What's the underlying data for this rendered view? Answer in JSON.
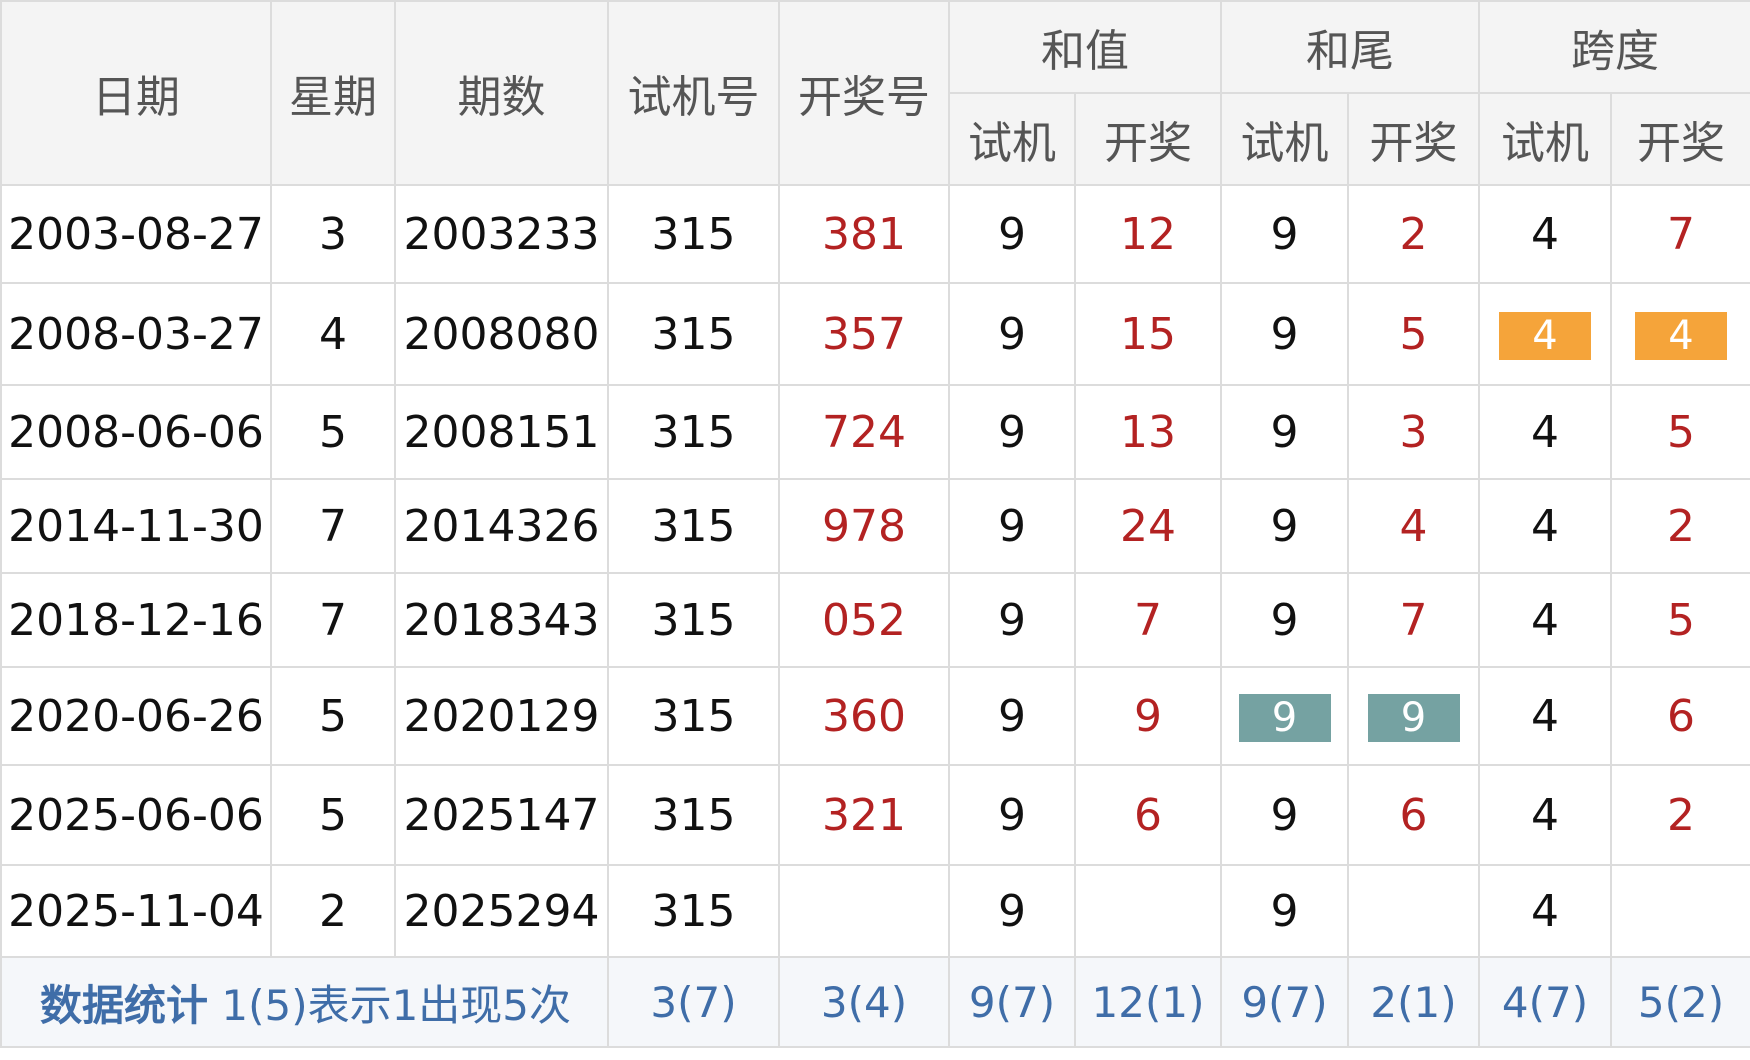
{
  "header": {
    "date": "日期",
    "weekday": "星期",
    "issue": "期数",
    "test_number": "试机号",
    "draw_number": "开奖号",
    "sum": "和值",
    "sum_tail": "和尾",
    "span": "跨度",
    "sub_test": "试机",
    "sub_draw": "开奖"
  },
  "rows": [
    {
      "date": "2003-08-27",
      "weekday": "3",
      "issue": "2003233",
      "test": "315",
      "draw": "381",
      "sum_test": "9",
      "sum_draw": "12",
      "tail_test": "9",
      "tail_draw": "2",
      "span_test": "4",
      "span_draw": "7"
    },
    {
      "date": "2008-03-27",
      "weekday": "4",
      "issue": "2008080",
      "test": "315",
      "draw": "357",
      "sum_test": "9",
      "sum_draw": "15",
      "tail_test": "9",
      "tail_draw": "5",
      "span_test": "4",
      "span_draw": "4"
    },
    {
      "date": "2008-06-06",
      "weekday": "5",
      "issue": "2008151",
      "test": "315",
      "draw": "724",
      "sum_test": "9",
      "sum_draw": "13",
      "tail_test": "9",
      "tail_draw": "3",
      "span_test": "4",
      "span_draw": "5"
    },
    {
      "date": "2014-11-30",
      "weekday": "7",
      "issue": "2014326",
      "test": "315",
      "draw": "978",
      "sum_test": "9",
      "sum_draw": "24",
      "tail_test": "9",
      "tail_draw": "4",
      "span_test": "4",
      "span_draw": "2"
    },
    {
      "date": "2018-12-16",
      "weekday": "7",
      "issue": "2018343",
      "test": "315",
      "draw": "052",
      "sum_test": "9",
      "sum_draw": "7",
      "tail_test": "9",
      "tail_draw": "7",
      "span_test": "4",
      "span_draw": "5"
    },
    {
      "date": "2020-06-26",
      "weekday": "5",
      "issue": "2020129",
      "test": "315",
      "draw": "360",
      "sum_test": "9",
      "sum_draw": "9",
      "tail_test": "9",
      "tail_draw": "9",
      "span_test": "4",
      "span_draw": "6"
    },
    {
      "date": "2025-06-06",
      "weekday": "5",
      "issue": "2025147",
      "test": "315",
      "draw": "321",
      "sum_test": "9",
      "sum_draw": "6",
      "tail_test": "9",
      "tail_draw": "6",
      "span_test": "4",
      "span_draw": "2"
    },
    {
      "date": "2025-11-04",
      "weekday": "2",
      "issue": "2025294",
      "test": "315",
      "draw": "",
      "sum_test": "9",
      "sum_draw": "",
      "tail_test": "9",
      "tail_draw": "",
      "span_test": "4",
      "span_draw": ""
    }
  ],
  "stats": {
    "title": "数据统计",
    "note": "1(5)表示1出现5次",
    "test": "3(7)",
    "draw": "3(4)",
    "sum_test": "9(7)",
    "sum_draw": "12(1)",
    "tail_test": "9(7)",
    "tail_draw": "2(1)",
    "span_test": "4(7)",
    "span_draw": "5(2)"
  },
  "colors": {
    "draw_red": "#b32222",
    "highlight_orange": "#f5a43a",
    "highlight_teal": "#75a2a2",
    "stats_blue": "#3f6da8"
  }
}
